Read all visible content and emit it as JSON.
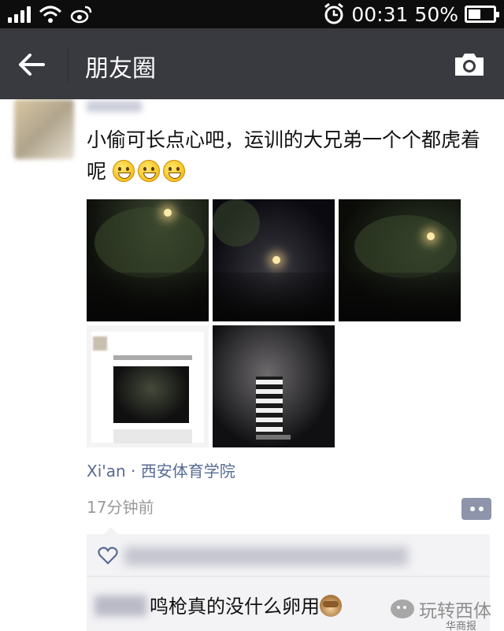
{
  "status_bar": {
    "time": "00:31",
    "battery": "50%",
    "battery_level": 0.5
  },
  "nav": {
    "title": "朋友圈"
  },
  "post": {
    "text": "小偷可长点心吧，运训的大兄弟一个个都虎着呢",
    "emoji_count": 3,
    "location": "Xi'an · 西安体育学院",
    "time_ago": "17分钟前",
    "comment_text": "鸣枪真的没什么卵用"
  },
  "watermark": {
    "label": "玩转西体",
    "sub": "华商报"
  },
  "colors": {
    "status_bar": "#0d0d0d",
    "nav_bar": "#393a3f",
    "link": "#576b95",
    "timestamp": "#9a9a9a",
    "interaction_bg": "#f3f3f5"
  }
}
